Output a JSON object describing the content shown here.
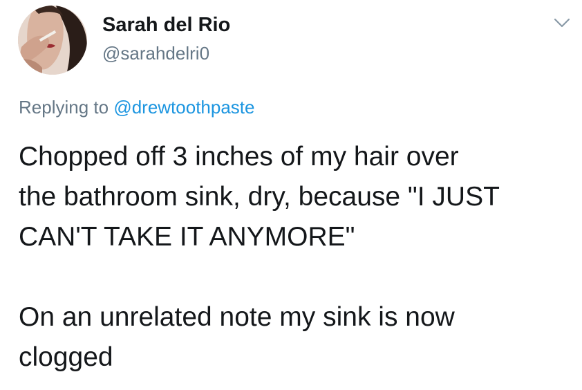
{
  "author": {
    "display_name": "Sarah del Rio",
    "handle": "@sarahdelri0"
  },
  "reply_context": {
    "prefix": "Replying to",
    "mention": "@drewtoothpaste"
  },
  "tweet_text": {
    "paragraph_1_lines": [
      "Chopped off 3 inches of my hair over",
      "the bathroom sink, dry, because \"I JUST",
      "CAN'T TAKE IT ANYMORE\""
    ],
    "paragraph_2_lines": [
      "On an unrelated note my sink is now",
      "clogged"
    ]
  },
  "icons": {
    "avatar": "profile-photo",
    "menu": "chevron-down-icon"
  },
  "colors": {
    "text_primary": "#14171a",
    "text_secondary": "#657786",
    "link": "#1b95e0",
    "caret": "#8899a6"
  }
}
